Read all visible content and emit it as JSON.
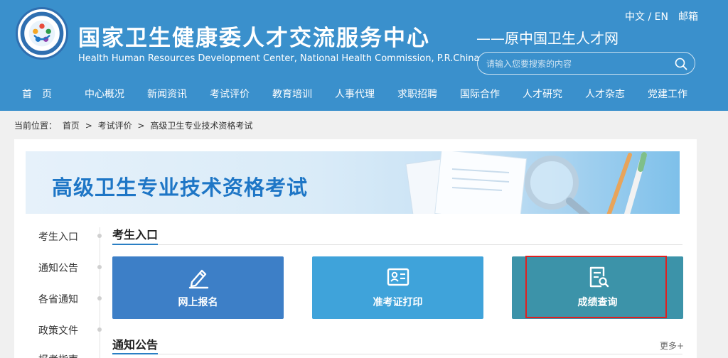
{
  "header": {
    "title_cn": "国家卫生健康委人才交流服务中心",
    "title_en": "Health Human Resources Development Center, National Health Commission, P.R.China",
    "slogan": "——原中国卫生人才网",
    "lang": "中文 / EN",
    "mailbox": "邮箱",
    "search_placeholder": "请输入您要搜索的内容",
    "colors": {
      "header_bg": "#3a90cc",
      "accent": "#1e76c6",
      "highlight": "#e02020"
    }
  },
  "nav": {
    "items": [
      "首　页",
      "中心概况",
      "新闻资讯",
      "考试评价",
      "教育培训",
      "人事代理",
      "求职招聘",
      "国际合作",
      "人才研究",
      "人才杂志",
      "党建工作"
    ]
  },
  "breadcrumb": {
    "prefix": "当前位置：",
    "items": [
      "首页",
      ">",
      "考试评价",
      ">",
      "高级卫生专业技术资格考试"
    ]
  },
  "banner": {
    "title": "高级卫生专业技术资格考试"
  },
  "sidebar": {
    "items": [
      "考生入口",
      "通知公告",
      "各省通知",
      "政策文件",
      "报考指南"
    ]
  },
  "sections": {
    "entry_title": "考生入口",
    "notice_title": "通知公告",
    "more": "更多+"
  },
  "tiles": [
    {
      "label": "网上报名",
      "icon": "edit-pencil-icon",
      "color": "#3d7fc7"
    },
    {
      "label": "准考证打印",
      "icon": "id-card-icon",
      "color": "#3fa3da"
    },
    {
      "label": "成绩查询",
      "icon": "document-search-icon",
      "color": "#3c93a9"
    }
  ]
}
